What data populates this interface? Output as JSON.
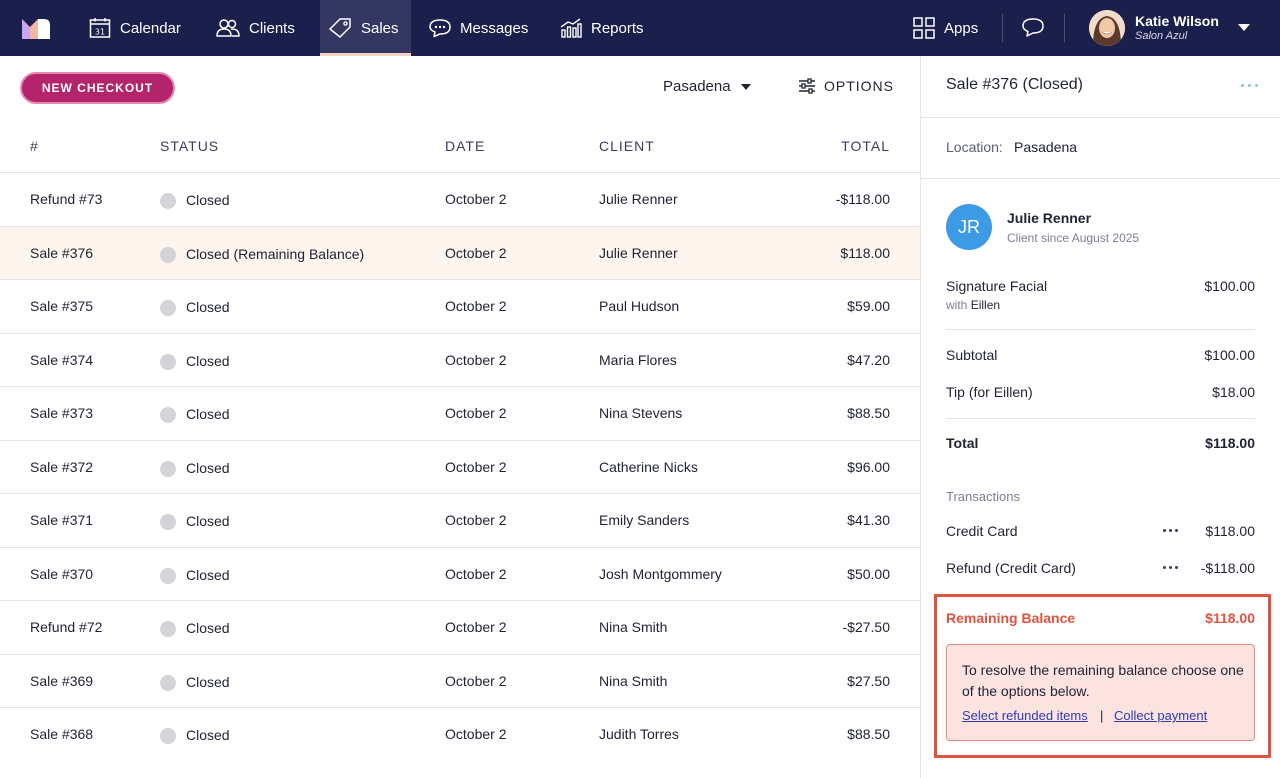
{
  "nav": {
    "items": [
      {
        "label": "Calendar",
        "icon": "calendar-icon"
      },
      {
        "label": "Clients",
        "icon": "clients-icon"
      },
      {
        "label": "Sales",
        "icon": "sales-tag-icon",
        "active": true
      },
      {
        "label": "Messages",
        "icon": "messages-icon"
      },
      {
        "label": "Reports",
        "icon": "reports-icon"
      }
    ],
    "calendar_day": "31",
    "apps_label": "Apps",
    "user": {
      "name": "Katie Wilson",
      "salon": "Salon Azul"
    }
  },
  "toolbar": {
    "new_checkout_label": "NEW CHECKOUT",
    "location": "Pasadena",
    "options_label": "OPTIONS"
  },
  "table": {
    "columns": [
      "#",
      "STATUS",
      "DATE",
      "CLIENT",
      "TOTAL"
    ],
    "rows": [
      {
        "num": "Refund #73",
        "status": "Closed",
        "date": "October 2",
        "client": "Julie Renner",
        "total": "-$118.00"
      },
      {
        "num": "Sale #376",
        "status": "Closed (Remaining Balance)",
        "date": "October 2",
        "client": "Julie Renner",
        "total": "$118.00",
        "selected": true
      },
      {
        "num": "Sale #375",
        "status": "Closed",
        "date": "October 2",
        "client": "Paul Hudson",
        "total": "$59.00"
      },
      {
        "num": "Sale #374",
        "status": "Closed",
        "date": "October 2",
        "client": "Maria Flores",
        "total": "$47.20"
      },
      {
        "num": "Sale #373",
        "status": "Closed",
        "date": "October 2",
        "client": "Nina Stevens",
        "total": "$88.50"
      },
      {
        "num": "Sale #372",
        "status": "Closed",
        "date": "October 2",
        "client": "Catherine Nicks",
        "total": "$96.00"
      },
      {
        "num": "Sale #371",
        "status": "Closed",
        "date": "October 2",
        "client": "Emily Sanders",
        "total": "$41.30"
      },
      {
        "num": "Sale #370",
        "status": "Closed",
        "date": "October 2",
        "client": "Josh Montgommery",
        "total": "$50.00"
      },
      {
        "num": "Refund #72",
        "status": "Closed",
        "date": "October 2",
        "client": "Nina Smith",
        "total": "-$27.50"
      },
      {
        "num": "Sale #369",
        "status": "Closed",
        "date": "October 2",
        "client": "Nina Smith",
        "total": "$27.50"
      },
      {
        "num": "Sale #368",
        "status": "Closed",
        "date": "October 2",
        "client": "Judith Torres",
        "total": "$88.50"
      }
    ]
  },
  "panel": {
    "title": "Sale #376 (Closed)",
    "location_label": "Location:",
    "location_value": "Pasadena",
    "client": {
      "initials": "JR",
      "name": "Julie Renner",
      "since": "Client since August 2025"
    },
    "item": {
      "name": "Signature Facial",
      "with_prefix": "with",
      "staff": "Eillen",
      "price": "$100.00"
    },
    "subtotal_label": "Subtotal",
    "subtotal_value": "$100.00",
    "tip_label": "Tip (for Eillen)",
    "tip_value": "$18.00",
    "total_label": "Total",
    "total_value": "$118.00",
    "transactions_label": "Transactions",
    "transactions": [
      {
        "label": "Credit Card",
        "amount": "$118.00"
      },
      {
        "label": "Refund (Credit Card)",
        "amount": "-$118.00"
      }
    ],
    "remaining_label": "Remaining Balance",
    "remaining_value": "$118.00",
    "notice_text": "To resolve the remaining balance choose one of the options below.",
    "link_refunded": "Select refunded items",
    "link_separator": "|",
    "link_collect": "Collect payment"
  },
  "colors": {
    "nav_bg": "#1b1f4b",
    "accent": "#b3246b",
    "alert": "#e0533f",
    "avatar_blue": "#3d9be6"
  }
}
